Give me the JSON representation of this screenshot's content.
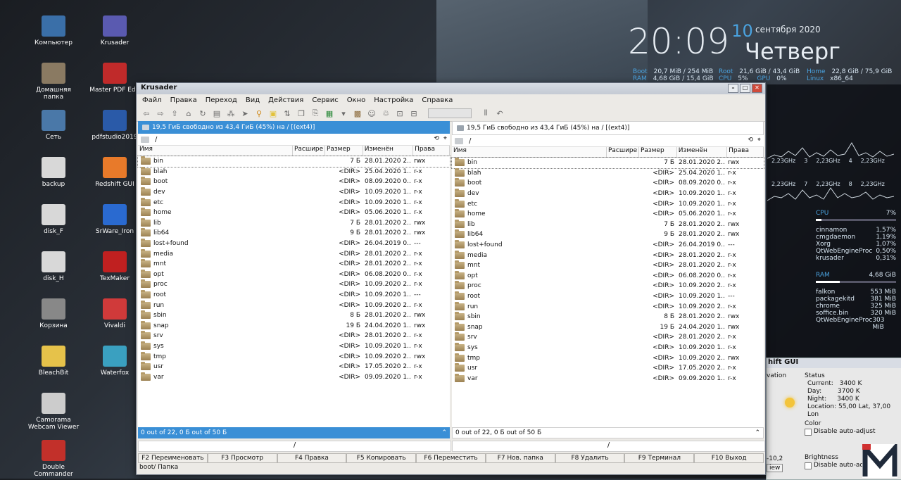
{
  "desktop": {
    "icons_left": [
      "Компьютер",
      "Домашняя папка",
      "Сеть",
      "backup",
      "disk_F",
      "disk_H",
      "Корзина",
      "BleachBit",
      "Camorama\nWebcam Viewer",
      "Double\nCommander"
    ],
    "icons_right": [
      "Krusader",
      "Master PDF Edit",
      "pdfstudio2019",
      "Redshift GUI",
      "SrWare_Iron",
      "TexMaker",
      "Vivaldi",
      "Waterfox"
    ]
  },
  "clock": {
    "time": "20:09",
    "day": "10",
    "month_year": "сентября 2020",
    "weekday": "Четверг"
  },
  "sysinfo": {
    "boot_label": "Boot",
    "boot_val": "20,7 MiB / 254 MiB",
    "ram_label": "RAM",
    "ram_val": "4,68 GiB / 15,4 GiB",
    "root_label": "Root",
    "root_val": "21,6 GiB / 43,4 GiB",
    "cpu_label": "CPU",
    "cpu_val": "5%",
    "gpu_label": "GPU",
    "gpu_val": "0%",
    "home_label": "Home",
    "home_val": "22,8 GiB / 75,9 GiB",
    "linux_label": "Linux",
    "linux_val": "x86_64",
    "cores": [
      "2,23GHz",
      "3",
      "2,23GHz",
      "4",
      "2,23GHz",
      "7",
      "2,23GHz",
      "8",
      "2,23GHz"
    ],
    "cpu_title": "CPU",
    "cpu_total": "7%",
    "procs": [
      [
        "cinnamon",
        "1,57%"
      ],
      [
        "cmgdaemon",
        "1,19%"
      ],
      [
        "Xorg",
        "1,07%"
      ],
      [
        "QtWebEngineProc",
        "0,50%"
      ],
      [
        "krusader",
        "0,31%"
      ]
    ],
    "ram_title": "RAM",
    "ram_total": "4,68 GiB",
    "mem": [
      [
        "falkon",
        "553 MiB"
      ],
      [
        "packagekitd",
        "381 MiB"
      ],
      [
        "chrome",
        "325 MiB"
      ],
      [
        "soffice.bin",
        "320 MiB"
      ],
      [
        "QtWebEngineProc",
        "303 MiB"
      ]
    ]
  },
  "redshift": {
    "title": "hift GUI",
    "elevation": "vation",
    "status": "Status",
    "current_label": "Current:",
    "current": "3400 K",
    "day_label": "Day:",
    "day": "3700 K",
    "night_label": "Night:",
    "night": "3400 K",
    "location_label": "Location:",
    "location": "55,00 Lat, 37,00 Lon",
    "color": "Color",
    "disable": "Disable auto-adjust",
    "brightness": "Brightness",
    "disable2": "Disable auto-adjust",
    "neg": "-10,2",
    "view": "iew"
  },
  "window": {
    "title": "Krusader",
    "menu": [
      "Файл",
      "Правка",
      "Переход",
      "Вид",
      "Действия",
      "Сервис",
      "Окно",
      "Настройка",
      "Справка"
    ],
    "left_free": "19,5 ГиБ свободно из 43,4 ГиБ (45%) на / [(ext4)]",
    "right_free": "19,5 ГиБ свободно из 43,4 ГиБ (45%) на / [(ext4)]",
    "path": "/",
    "columns": [
      "Имя",
      "Расшире",
      "Размер",
      "Изменён",
      "Права"
    ],
    "rows": [
      [
        "bin",
        "7 Б",
        "28.01.2020 2...",
        "rwx"
      ],
      [
        "blah",
        "<DIR>",
        "25.04.2020 1...",
        "r-x"
      ],
      [
        "boot",
        "<DIR>",
        "08.09.2020 0...",
        "r-x"
      ],
      [
        "dev",
        "<DIR>",
        "10.09.2020 1...",
        "r-x"
      ],
      [
        "etc",
        "<DIR>",
        "10.09.2020 1...",
        "r-x"
      ],
      [
        "home",
        "<DIR>",
        "05.06.2020 1...",
        "r-x"
      ],
      [
        "lib",
        "7 Б",
        "28.01.2020 2...",
        "rwx"
      ],
      [
        "lib64",
        "9 Б",
        "28.01.2020 2...",
        "rwx"
      ],
      [
        "lost+found",
        "<DIR>",
        "26.04.2019 0...",
        "---"
      ],
      [
        "media",
        "<DIR>",
        "28.01.2020 2...",
        "r-x"
      ],
      [
        "mnt",
        "<DIR>",
        "28.01.2020 2...",
        "r-x"
      ],
      [
        "opt",
        "<DIR>",
        "06.08.2020 0...",
        "r-x"
      ],
      [
        "proc",
        "<DIR>",
        "10.09.2020 2...",
        "r-x"
      ],
      [
        "root",
        "<DIR>",
        "10.09.2020 1...",
        "---"
      ],
      [
        "run",
        "<DIR>",
        "10.09.2020 2...",
        "r-x"
      ],
      [
        "sbin",
        "8 Б",
        "28.01.2020 2...",
        "rwx"
      ],
      [
        "snap",
        "19 Б",
        "24.04.2020 1...",
        "rwx"
      ],
      [
        "srv",
        "<DIR>",
        "28.01.2020 2...",
        "r-x"
      ],
      [
        "sys",
        "<DIR>",
        "10.09.2020 1...",
        "r-x"
      ],
      [
        "tmp",
        "<DIR>",
        "10.09.2020 2...",
        "rwx"
      ],
      [
        "usr",
        "<DIR>",
        "17.05.2020 2...",
        "r-x"
      ],
      [
        "var",
        "<DIR>",
        "09.09.2020 1...",
        "r-x"
      ]
    ],
    "left_status": "0 out of 22, 0 Б out of 50 Б",
    "right_status": "0 out of 22, 0 Б out of 50 Б",
    "cmd_path": "/",
    "fkeys": [
      "F2 Переименовать",
      "F3 Просмотр",
      "F4 Правка",
      "F5 Копировать",
      "F6 Переместить",
      "F7 Нов. папка",
      "F8 Удалить",
      "F9 Терминал",
      "F10 Выход"
    ],
    "bottom": "boot/  Папка"
  }
}
